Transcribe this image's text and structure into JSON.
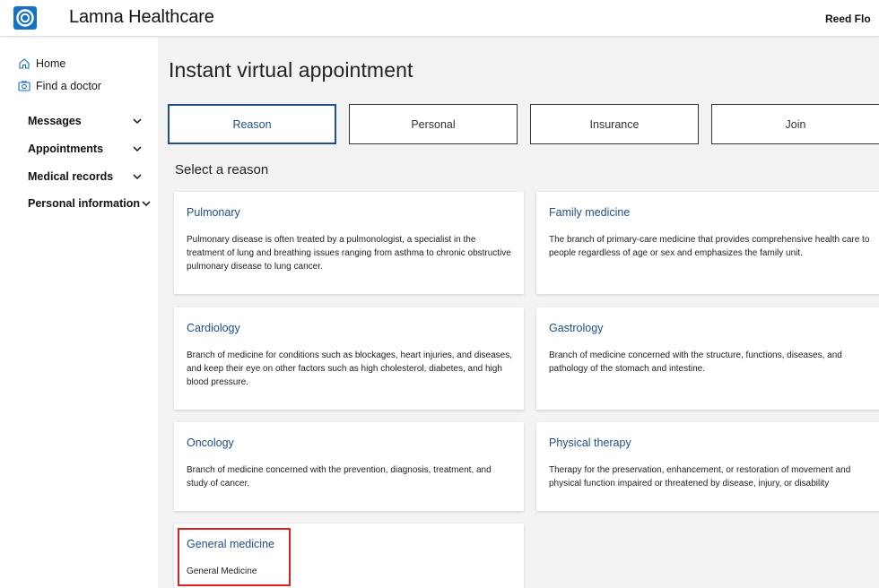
{
  "app": {
    "brand": "Lamna Healthcare",
    "user": "Reed Flo"
  },
  "sidebar": {
    "links": [
      {
        "label": "Home",
        "icon": "home-icon"
      },
      {
        "label": "Find a doctor",
        "icon": "camera-icon"
      }
    ],
    "groups": [
      {
        "label": "Messages"
      },
      {
        "label": "Appointments"
      },
      {
        "label": "Medical records"
      },
      {
        "label": "Personal information"
      }
    ]
  },
  "main": {
    "title": "Instant virtual appointment",
    "tabs": [
      {
        "label": "Reason",
        "active": true
      },
      {
        "label": "Personal",
        "active": false
      },
      {
        "label": "Insurance",
        "active": false
      },
      {
        "label": "Join",
        "active": false
      }
    ],
    "section_title": "Select a reason",
    "cards": [
      {
        "title": "Pulmonary",
        "description": "Pulmonary disease is often treated by a pulmonologist, a specialist in the treatment of lung and breathing issues ranging from asthma to chronic obstructive pulmonary disease to lung cancer."
      },
      {
        "title": "Family medicine",
        "description": "The branch of primary-care medicine that provides comprehensive health care to people regardless of age or sex and emphasizes the family unit."
      },
      {
        "title": "Cardiology",
        "description": "Branch of medicine for conditions such as blockages, heart injuries, and diseases, and keep their eye on other factors such as high cholesterol, diabetes, and high blood pressure."
      },
      {
        "title": "Gastrology",
        "description": "Branch of medicine concerned with the structure, functions, diseases, and pathology of the stomach and intestine."
      },
      {
        "title": "Oncology",
        "description": "Branch of medicine concerned with the prevention, diagnosis, treatment, and study of cancer."
      },
      {
        "title": "Physical therapy",
        "description": "Therapy for the preservation, enhancement, or restoration of movement and physical function impaired or threatened by disease, injury, or disability"
      },
      {
        "title": "General medicine",
        "description": "General Medicine"
      }
    ]
  },
  "colors": {
    "accent": "#1e4f8a",
    "brand_blue": "#1472c4",
    "highlight": "#e0201c"
  }
}
